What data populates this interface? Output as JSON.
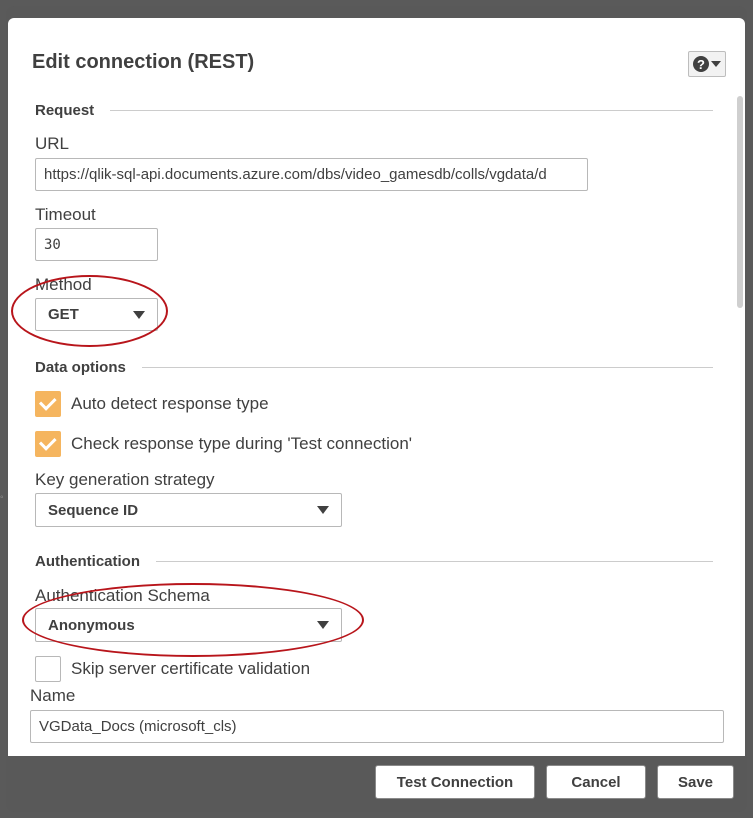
{
  "dialog": {
    "title": "Edit connection (REST)",
    "help_symbol": "?"
  },
  "request": {
    "section_label": "Request",
    "url_label": "URL",
    "url_value": "https://qlik-sql-api.documents.azure.com/dbs/video_gamesdb/colls/vgdata/d",
    "timeout_label": "Timeout",
    "timeout_value": "30",
    "method_label": "Method",
    "method_value": "GET"
  },
  "data_options": {
    "section_label": "Data options",
    "auto_detect_label": "Auto detect response type",
    "auto_detect_checked": true,
    "check_response_label": "Check response type during 'Test connection'",
    "check_response_checked": true,
    "key_strategy_label": "Key generation strategy",
    "key_strategy_value": "Sequence ID"
  },
  "authentication": {
    "section_label": "Authentication",
    "schema_label": "Authentication Schema",
    "schema_value": "Anonymous",
    "skip_cert_label": "Skip server certificate validation",
    "skip_cert_checked": false
  },
  "name": {
    "label": "Name",
    "value": "VGData_Docs (microsoft_cls)"
  },
  "footer": {
    "test_connection": "Test Connection",
    "cancel": "Cancel",
    "save": "Save"
  },
  "colors": {
    "accent_checkbox": "#f5b55f",
    "annotation_red": "#b8151b",
    "footer_bg": "#595959"
  }
}
